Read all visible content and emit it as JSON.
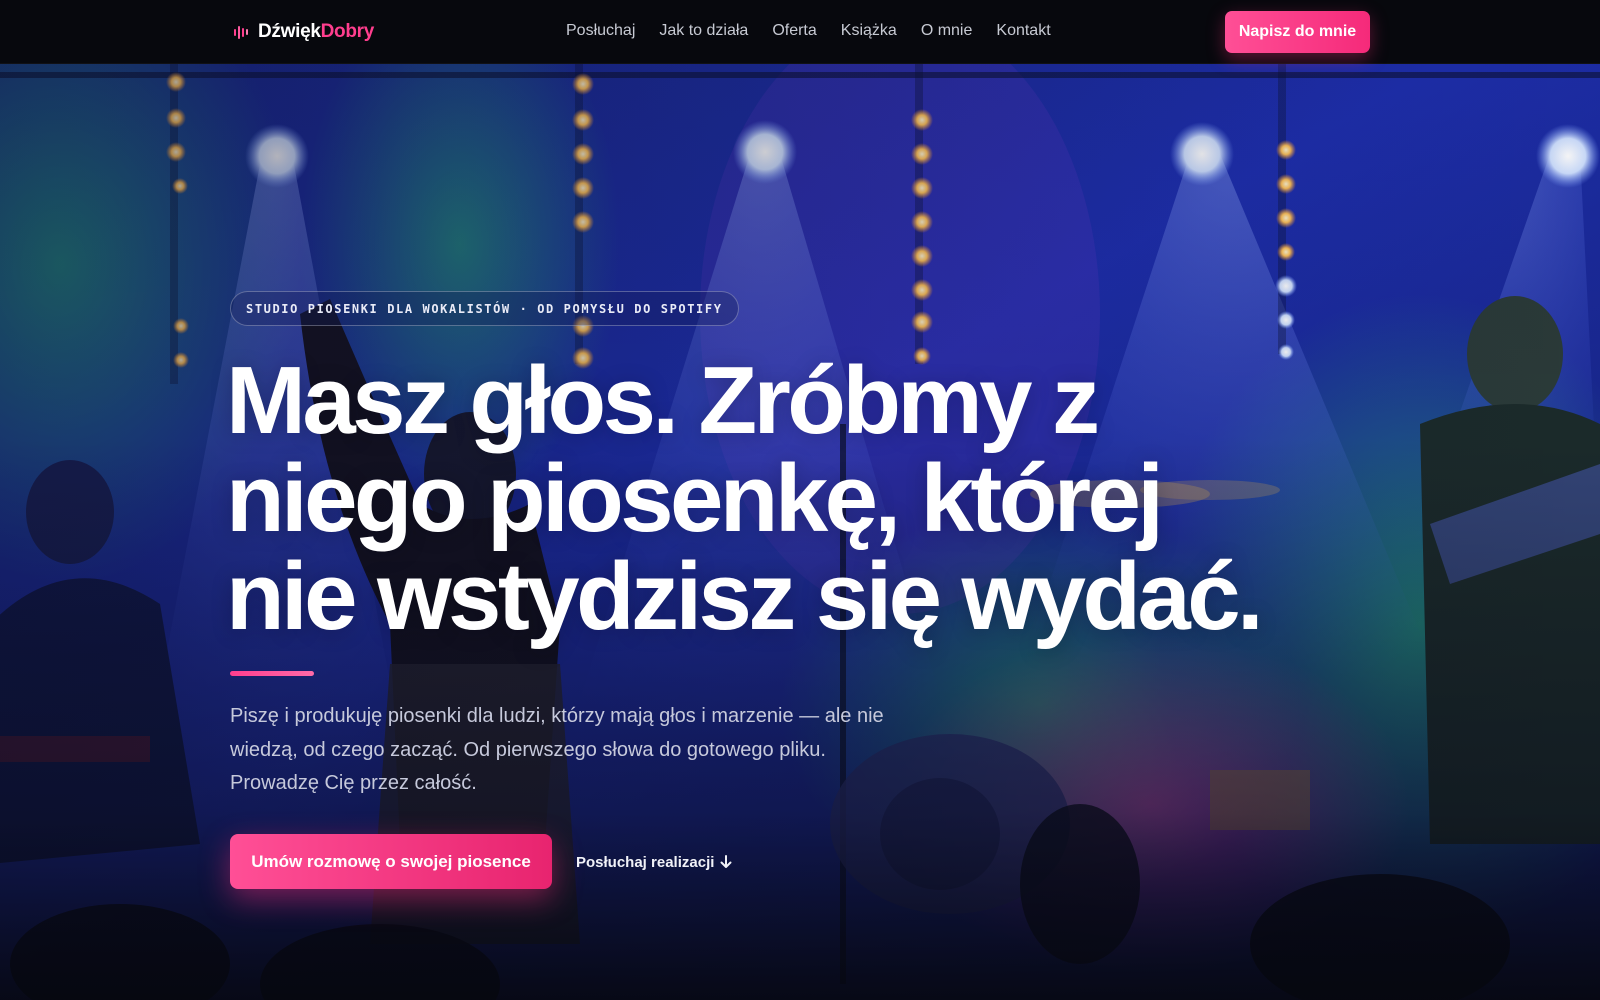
{
  "brand": {
    "name_part1": "Dźwięk",
    "name_part2": "Dobry",
    "icon": "sound-wave-icon",
    "accent_color": "#ff3e8e"
  },
  "nav": {
    "items": [
      "Posłuchaj",
      "Jak to działa",
      "Oferta",
      "Książka",
      "O mnie",
      "Kontakt"
    ],
    "cta_label": "Napisz do mnie"
  },
  "hero": {
    "eyebrow": "STUDIO PIOSENKI DLA WOKALISTÓW · OD POMYSŁU DO SPOTIFY",
    "headline_lines": [
      "Masz głos. Zróbmy z",
      "niego piosenkę, której",
      "nie wstydzisz się wydać."
    ],
    "lead": "Piszę i produkuję piosenki dla ludzi, którzy mają głos i marzenie — ale nie wiedzą, od czego zacząć. Od pierwszego słowa do gotowego pliku. Prowadzę Cię przez całość.",
    "primary_cta": "Umów rozmowę o swojej piosence",
    "secondary_cta": "Posłuchaj realizacji",
    "secondary_cta_icon": "arrow-down-icon",
    "background_image": "concert-stage-photo"
  }
}
